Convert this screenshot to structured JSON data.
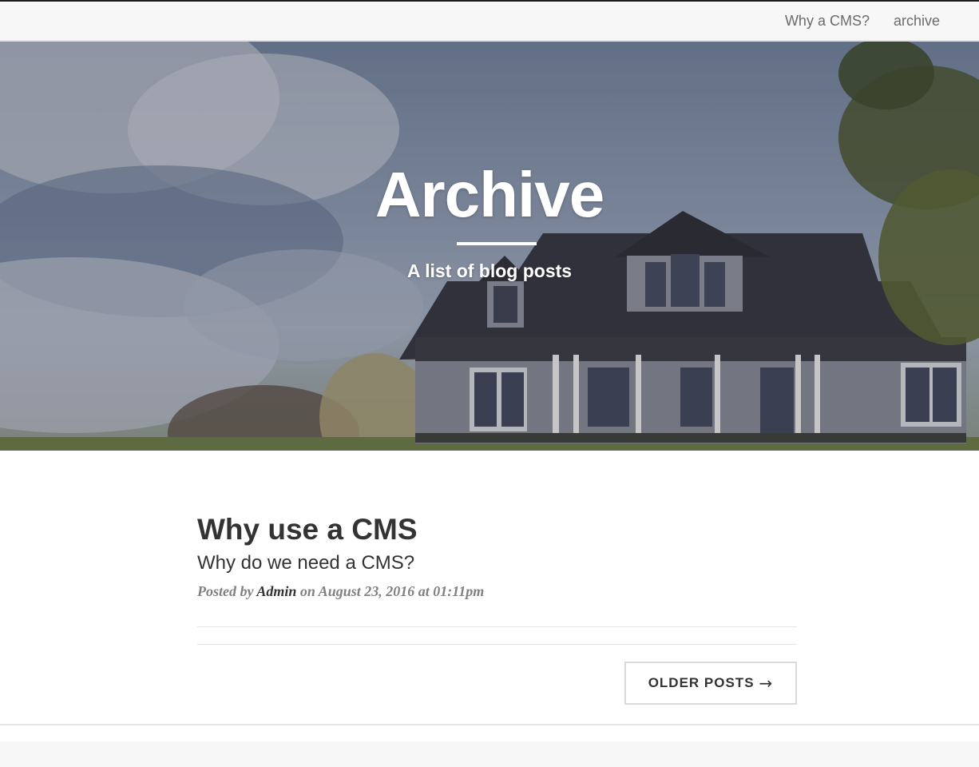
{
  "nav": {
    "links": [
      {
        "label": "Why a CMS?"
      },
      {
        "label": "archive"
      }
    ]
  },
  "hero": {
    "title": "Archive",
    "subtitle": "A list of blog posts"
  },
  "posts": [
    {
      "title": "Why use a CMS",
      "subtitle": "Why do we need a CMS?",
      "meta_prefix": "Posted by ",
      "author": "Admin",
      "meta_suffix": " on August 23, 2016 at 01:11pm"
    }
  ],
  "pager": {
    "older_label": "OLDER POSTS",
    "older_arrow": "→"
  }
}
